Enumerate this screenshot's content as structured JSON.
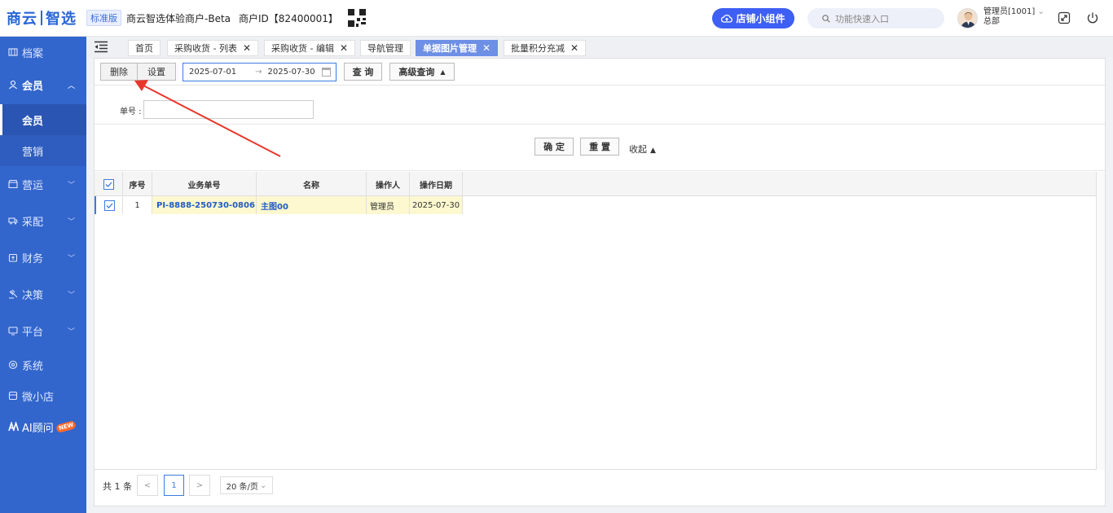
{
  "header": {
    "logo_left": "商云",
    "logo_right": "智选",
    "edition": "标准版",
    "merchant_name": "商云智选体验商户-Beta",
    "merchant_id": "商户ID【82400001】",
    "widget_button": "店铺小组件",
    "search_placeholder": "功能快速入口",
    "user_name": "管理员[1001]",
    "user_org": "总部"
  },
  "sidebar": {
    "items": [
      {
        "label": "档案"
      },
      {
        "label": "会员"
      },
      {
        "label": "会员"
      },
      {
        "label": "营销"
      },
      {
        "label": "营运"
      },
      {
        "label": "采配"
      },
      {
        "label": "财务"
      },
      {
        "label": "决策"
      },
      {
        "label": "平台"
      },
      {
        "label": "系统"
      },
      {
        "label": "微小店"
      },
      {
        "label": "AI顾问"
      }
    ],
    "new_badge": "NEW"
  },
  "tabs": [
    {
      "label": "首页"
    },
    {
      "label": "采购收货 - 列表"
    },
    {
      "label": "采购收货 - 编辑"
    },
    {
      "label": "导航管理"
    },
    {
      "label": "单据图片管理"
    },
    {
      "label": "批量积分充减"
    }
  ],
  "toolbar": {
    "delete": "删除",
    "settings": "设置",
    "date_start": "2025-07-01",
    "date_end": "2025-07-30",
    "date_arrow": "→",
    "query": "查 询",
    "advanced_query": "高级查询"
  },
  "filter": {
    "doc_no_label": "单号 :",
    "doc_no_value": ""
  },
  "actions": {
    "confirm": "确 定",
    "reset": "重 置",
    "collapse": "收起"
  },
  "table": {
    "columns": [
      "序号",
      "业务单号",
      "名称",
      "操作人",
      "操作日期"
    ],
    "rows": [
      {
        "index": "1",
        "doc_no": "PI-8888-250730-0806",
        "name": "主图00",
        "operator": "管理员",
        "date": "2025-07-30"
      }
    ]
  },
  "pager": {
    "total": "共 1 条",
    "prev": "<",
    "current_page": "1",
    "next": ">",
    "page_size": "20 条/页"
  },
  "colors": {
    "sidebar": "#3366cc",
    "accent": "#3d5ff3",
    "active_tab": "#6d8fe6",
    "row_highlight": "#fdf8cf",
    "annotation_arrow": "#e8362b"
  }
}
